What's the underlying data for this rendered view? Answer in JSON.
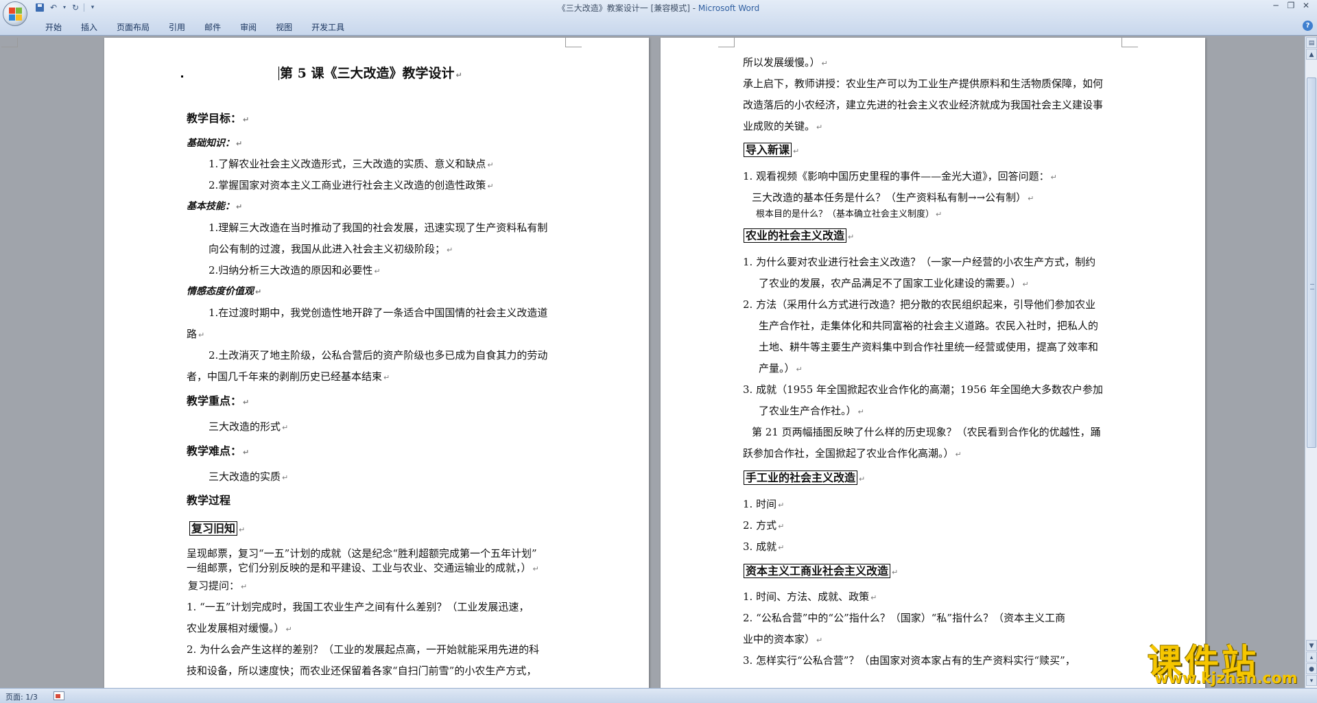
{
  "window": {
    "title_doc": "《三大改造》教案设计一 [兼容模式] - ",
    "title_app": "Microsoft Word"
  },
  "ribbon_tabs": [
    "开始",
    "插入",
    "页面布局",
    "引用",
    "邮件",
    "审阅",
    "视图",
    "开发工具"
  ],
  "page1": {
    "title": "第 5 课《三大改造》教学设计",
    "goals_heading": "教学目标：",
    "basic_knowledge": "基础知识：",
    "bk1": "1.了解农业社会主义改造形式，三大改造的实质、意义和缺点",
    "bk2": "2.掌握国家对资本主义工商业进行社会主义改造的创造性政策",
    "basic_skills": "基本技能：",
    "bs1a": "1.理解三大改造在当时推动了我国的社会发展，迅速实现了生产资料私有制",
    "bs1b": "向公有制的过渡，我国从此进入社会主义初级阶段；",
    "bs2": "2.归纳分析三大改造的原因和必要性",
    "emotion": "情感态度价值观",
    "em1a": "1.在过渡时期中，我党创造性地开辟了一条适合中国国情的社会主义改造道",
    "em1b": "路",
    "em2a": "2.土改消灭了地主阶级，公私合营后的资产阶级也多已成为自食其力的劳动",
    "em2b": "者，中国几千年来的剥削历史已经基本结束",
    "key_heading": "教学重点：",
    "key_text": "三大改造的形式",
    "diff_heading": "教学难点：",
    "diff_text": "三大改造的实质",
    "process_heading": "教学过程",
    "review_box": "复习旧知",
    "rv1": "呈现邮票，复习“一五”计划的成就（这是纪念“胜利超额完成第一个五年计划”",
    "rv2": "一组邮票，它们分别反映的是和平建设、工业与农业、交通运输业的成就，）",
    "rv3": "复习提问：",
    "q1a": "1. “一五”计划完成时，我国工农业生产之间有什么差别？（工业发展迅速，",
    "q1b": "农业发展相对缓慢。）",
    "q2a": "2. 为什么会产生这样的差别？（工业的发展起点高，一开始就能采用先进的科",
    "q2b": "技和设备，所以速度快；而农业还保留着各家“自扫门前雪”的小农生产方式，"
  },
  "page2": {
    "l1": "所以发展缓慢。）",
    "l2": "承上启下，教师讲授：农业生产可以为工业生产提供原料和生活物质保障，如何",
    "l3": "改造落后的小农经济，建立先进的社会主义农业经济就成为我国社会主义建设事",
    "l4": "业成败的关键。",
    "intro_box": "导入新课",
    "i1": "1. 观看视频《影响中国历史里程的事件——金光大道》，回答问题：",
    "i2": "三大改造的基本任务是什么？（生产资料私有制→→公有制）",
    "i3": "根本目的是什么？（基本确立社会主义制度）",
    "agri_box": "农业的社会主义改造",
    "a1a": "1. 为什么要对农业进行社会主义改造？（一家一户经营的小农生产方式，制约",
    "a1b": "了农业的发展，农产品满足不了国家工业化建设的需要。）",
    "a2a": "2. 方法（采用什么方式进行改造？把分散的农民组织起来，引导他们参加农业",
    "a2b": "生产合作社，走集体化和共同富裕的社会主义道路。农民入社时，把私人的",
    "a2c": "土地、耕牛等主要生产资料集中到合作社里统一经营或使用，提高了效率和",
    "a2d": "产量。）",
    "a3a": "3. 成就（1955 年全国掀起农业合作化的高潮；1956 年全国绝大多数农户参加",
    "a3b": "了农业生产合作社。）",
    "a4a": "第 21 页两幅插图反映了什么样的历史现象？（农民看到合作化的优越性，踊",
    "a4b": "跃参加合作社，全国掀起了农业合作化高潮。）",
    "hand_box": "手工业的社会主义改造",
    "h1": "1. 时间",
    "h2": "2. 方式",
    "h3": "3. 成就",
    "cap_box": "资本主义工商业社会主义改造",
    "c1": "1. 时间、方法、成就、政策",
    "c2a": "2. “公私合营”中的“公”指什么？（国家）“私”指什么？（资本主义工商",
    "c2b": "业中的资本家）",
    "c3": "3. 怎样实行“公私合营”？（由国家对资本家占有的生产资料实行“赎买”，"
  },
  "status": {
    "page": "页面: 1/3"
  },
  "watermark": {
    "main": "课件站",
    "url": "www.kjzhan.com"
  },
  "icons": {
    "save": "save-icon",
    "undo": "undo-icon",
    "redo": "redo-icon",
    "help": "help-icon",
    "paragraph": "paragraph-mark-icon"
  },
  "colors": {
    "ribbon": "#c8d7ec",
    "background": "#a0a4ab",
    "watermark": "#f6c600"
  }
}
